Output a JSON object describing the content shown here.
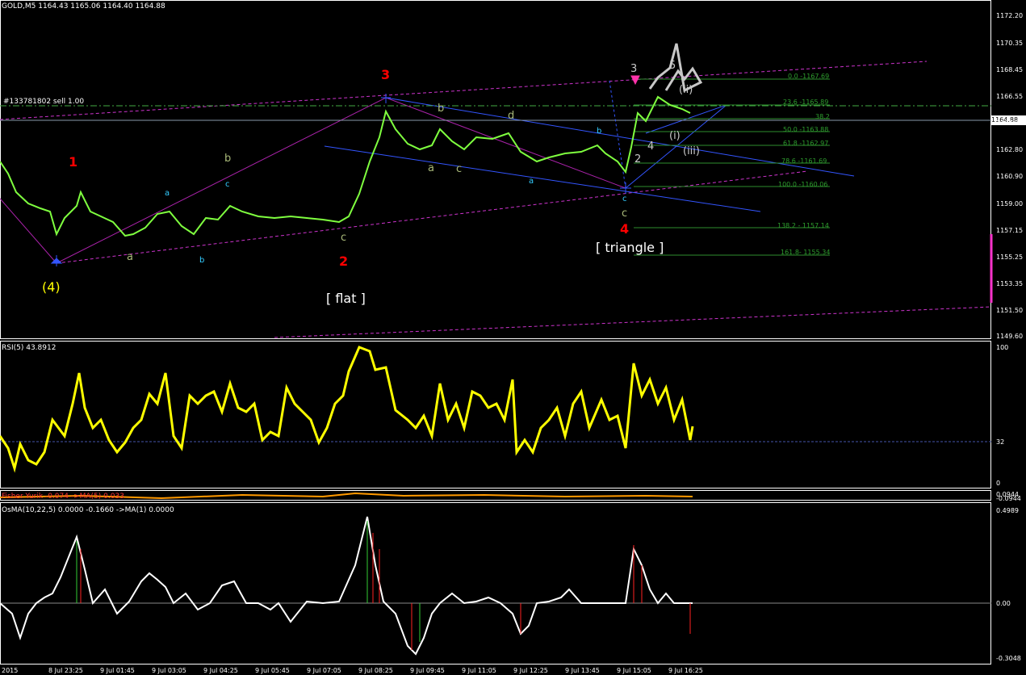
{
  "header": {
    "symbol_info": "GOLD,M5  1164.43 1165.06 1164.40 1164.88",
    "order_line": "#133781802 sell 1.00",
    "current_price": "1164.88"
  },
  "price_axis": [
    "1172.20",
    "1170.35",
    "1168.45",
    "1166.55",
    "1164.65",
    "1162.80",
    "1160.90",
    "1159.00",
    "1157.15",
    "1155.25",
    "1153.35",
    "1151.50",
    "1149.60"
  ],
  "wave_labels": {
    "wave4_paren": "(4)",
    "wave1": "1",
    "wave2": "2",
    "wave3": "3",
    "wave4": "4",
    "flat": "[ flat ]",
    "triangle": "[ triangle ]",
    "sub_a1": "a",
    "sub_b1": "b",
    "sub_a2": "a",
    "sub_b2": "b",
    "sub_c2": "c",
    "sub_c3": "c",
    "sub_a3": "a",
    "sub_b3": "b",
    "sub_c4": "c",
    "sub_d": "d",
    "sub_a4": "a",
    "sub_b4": "b",
    "sub_c5": "c",
    "sub_c6": "c",
    "sub_3": "3",
    "sub_2": "2",
    "sub_4": "4",
    "sub_5": "5",
    "sub_i": "(i)",
    "sub_ii": "(ii)",
    "sub_iii": "(iii)"
  },
  "fib_levels": [
    "0.0 -1167.69",
    "23.6 -1165.89",
    "38.2",
    "50.0 -1163.88",
    "61.8 -1162.97",
    "78.6 -1161.69",
    "100.0 -1160.06",
    "138.2 - 1157.14",
    "161.8- 1155.34"
  ],
  "rsi": {
    "title": "RSI(5) 43.8912",
    "axis": [
      "100",
      "32",
      "0"
    ]
  },
  "fisher": {
    "title": "Fisher Yurik -0.074 ->MA(5) 0.033",
    "axis_top": "0.0944",
    "axis_bottom": "-0.0944"
  },
  "osma": {
    "title": "OsMA(10,22,5) 0.0000 -0.1660 ->MA(1) 0.0000",
    "axis": [
      "0.4989",
      "0.00",
      "-0.3048"
    ]
  },
  "time_axis": [
    "2015",
    "8 Jul 23:25",
    "9 Jul 01:45",
    "9 Jul 03:05",
    "9 Jul 04:25",
    "9 Jul 05:45",
    "9 Jul 07:05",
    "9 Jul 08:25",
    "9 Jul 09:45",
    "9 Jul 11:05",
    "9 Jul 12:25",
    "9 Jul 13:45",
    "9 Jul 15:05",
    "9 Jul 16:25"
  ],
  "colors": {
    "background": "#000000",
    "candles": "#7fff3f",
    "rsi": "#ffff00",
    "channel": "#cc33cc",
    "trendline": "#3355ff",
    "fib": "#2e9e2e",
    "osma_up": "#33cc33",
    "osma_down": "#ff2222"
  }
}
